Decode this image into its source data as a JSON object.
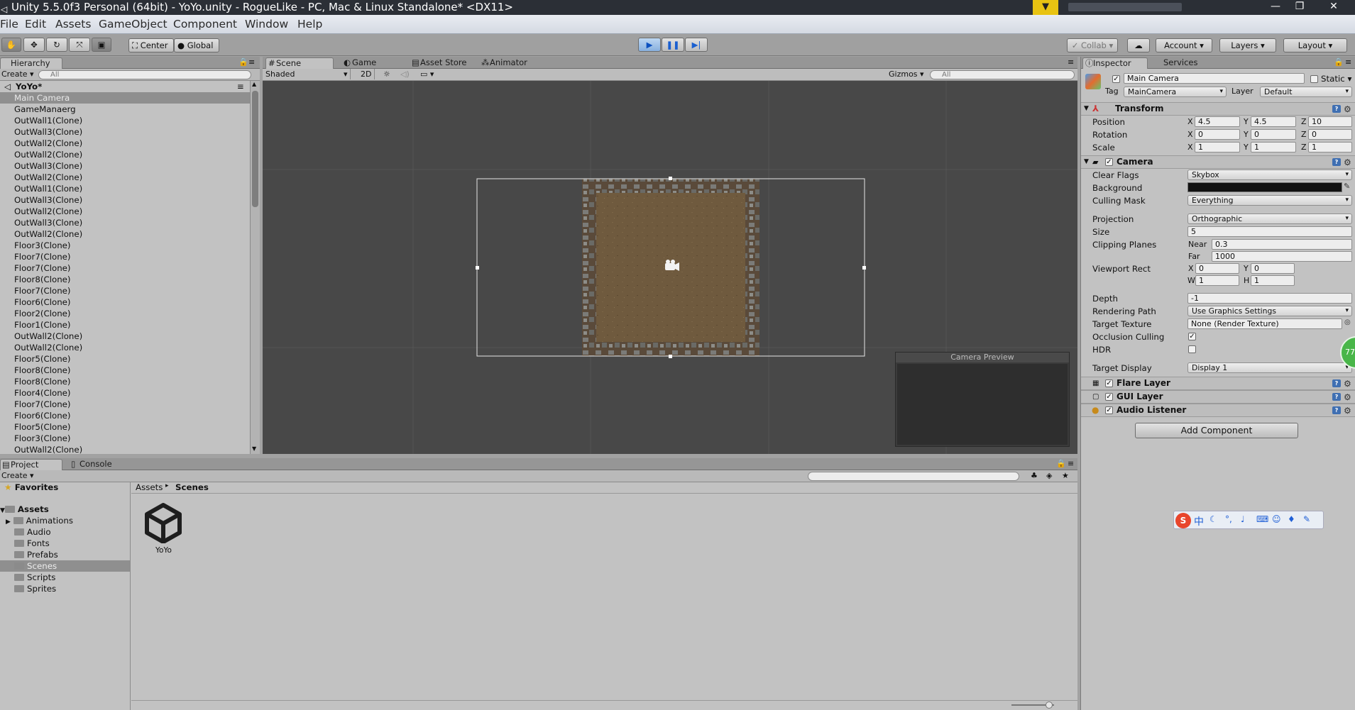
{
  "window": {
    "title": "Unity 5.5.0f3 Personal (64bit) - YoYo.unity - RogueLike - PC, Mac & Linux Standalone* <DX11>",
    "minimize": "—",
    "maximize": "❐",
    "close": "✕"
  },
  "menu": [
    "File",
    "Edit",
    "Assets",
    "GameObject",
    "Component",
    "Window",
    "Help"
  ],
  "toolbar": {
    "pivot": "Center",
    "space": "Global",
    "collab": "Collab",
    "account": "Account",
    "layers": "Layers",
    "layout": "Layout"
  },
  "hierarchy": {
    "tab": "Hierarchy",
    "create": "Create",
    "search": "All",
    "scene": "YoYo*",
    "items": [
      "Main Camera",
      "GameManaerg",
      "OutWall1(Clone)",
      "OutWall3(Clone)",
      "OutWall2(Clone)",
      "OutWall2(Clone)",
      "OutWall3(Clone)",
      "OutWall2(Clone)",
      "OutWall1(Clone)",
      "OutWall3(Clone)",
      "OutWall2(Clone)",
      "OutWall3(Clone)",
      "OutWall2(Clone)",
      "Floor3(Clone)",
      "Floor7(Clone)",
      "Floor7(Clone)",
      "Floor8(Clone)",
      "Floor7(Clone)",
      "Floor6(Clone)",
      "Floor2(Clone)",
      "Floor1(Clone)",
      "OutWall2(Clone)",
      "OutWall2(Clone)",
      "Floor5(Clone)",
      "Floor8(Clone)",
      "Floor8(Clone)",
      "Floor4(Clone)",
      "Floor7(Clone)",
      "Floor6(Clone)",
      "Floor5(Clone)",
      "Floor3(Clone)",
      "OutWall2(Clone)"
    ]
  },
  "scene": {
    "tabs": [
      "Scene",
      "Game",
      "Asset Store",
      "Animator"
    ],
    "shading": "Shaded",
    "mode2d": "2D",
    "gizmos": "Gizmos",
    "search": "All",
    "camera_preview": "Camera Preview"
  },
  "inspector": {
    "tabs": [
      "Inspector",
      "Services"
    ],
    "object_name": "Main Camera",
    "static": "Static",
    "tag_label": "Tag",
    "tag": "MainCamera",
    "layer_label": "Layer",
    "layer": "Default",
    "transform": {
      "title": "Transform",
      "position_label": "Position",
      "rotation_label": "Rotation",
      "scale_label": "Scale",
      "position": [
        "4.5",
        "4.5",
        "10"
      ],
      "rotation": [
        "0",
        "0",
        "0"
      ],
      "scale": [
        "1",
        "1",
        "1"
      ]
    },
    "camera": {
      "title": "Camera",
      "clear_flags_label": "Clear Flags",
      "clear_flags": "Skybox",
      "background_label": "Background",
      "background_color": "#111111",
      "culling_mask_label": "Culling Mask",
      "culling_mask": "Everything",
      "projection_label": "Projection",
      "projection": "Orthographic",
      "size_label": "Size",
      "size": "5",
      "clipping_label": "Clipping Planes",
      "near_label": "Near",
      "near": "0.3",
      "far_label": "Far",
      "far": "1000",
      "viewport_label": "Viewport Rect",
      "vx": "0",
      "vy": "0",
      "vw": "1",
      "vh": "1",
      "depth_label": "Depth",
      "depth": "-1",
      "rendering_path_label": "Rendering Path",
      "rendering_path": "Use Graphics Settings",
      "target_texture_label": "Target Texture",
      "target_texture": "None (Render Texture)",
      "occlusion_label": "Occlusion Culling",
      "hdr_label": "HDR",
      "target_display_label": "Target Display",
      "target_display": "Display 1"
    },
    "components": [
      "Flare Layer",
      "GUI Layer",
      "Audio Listener"
    ],
    "add_component": "Add Component"
  },
  "project": {
    "tabs": [
      "Project",
      "Console"
    ],
    "create": "Create",
    "favorites": "Favorites",
    "assets": "Assets",
    "folders": [
      "Animations",
      "Audio",
      "Fonts",
      "Prefabs",
      "Scenes",
      "Scripts",
      "Sprites"
    ],
    "breadcrumb": [
      "Assets",
      "Scenes"
    ],
    "content_item": "YoYo"
  },
  "ime": {
    "label": "中",
    "badge": "77"
  }
}
